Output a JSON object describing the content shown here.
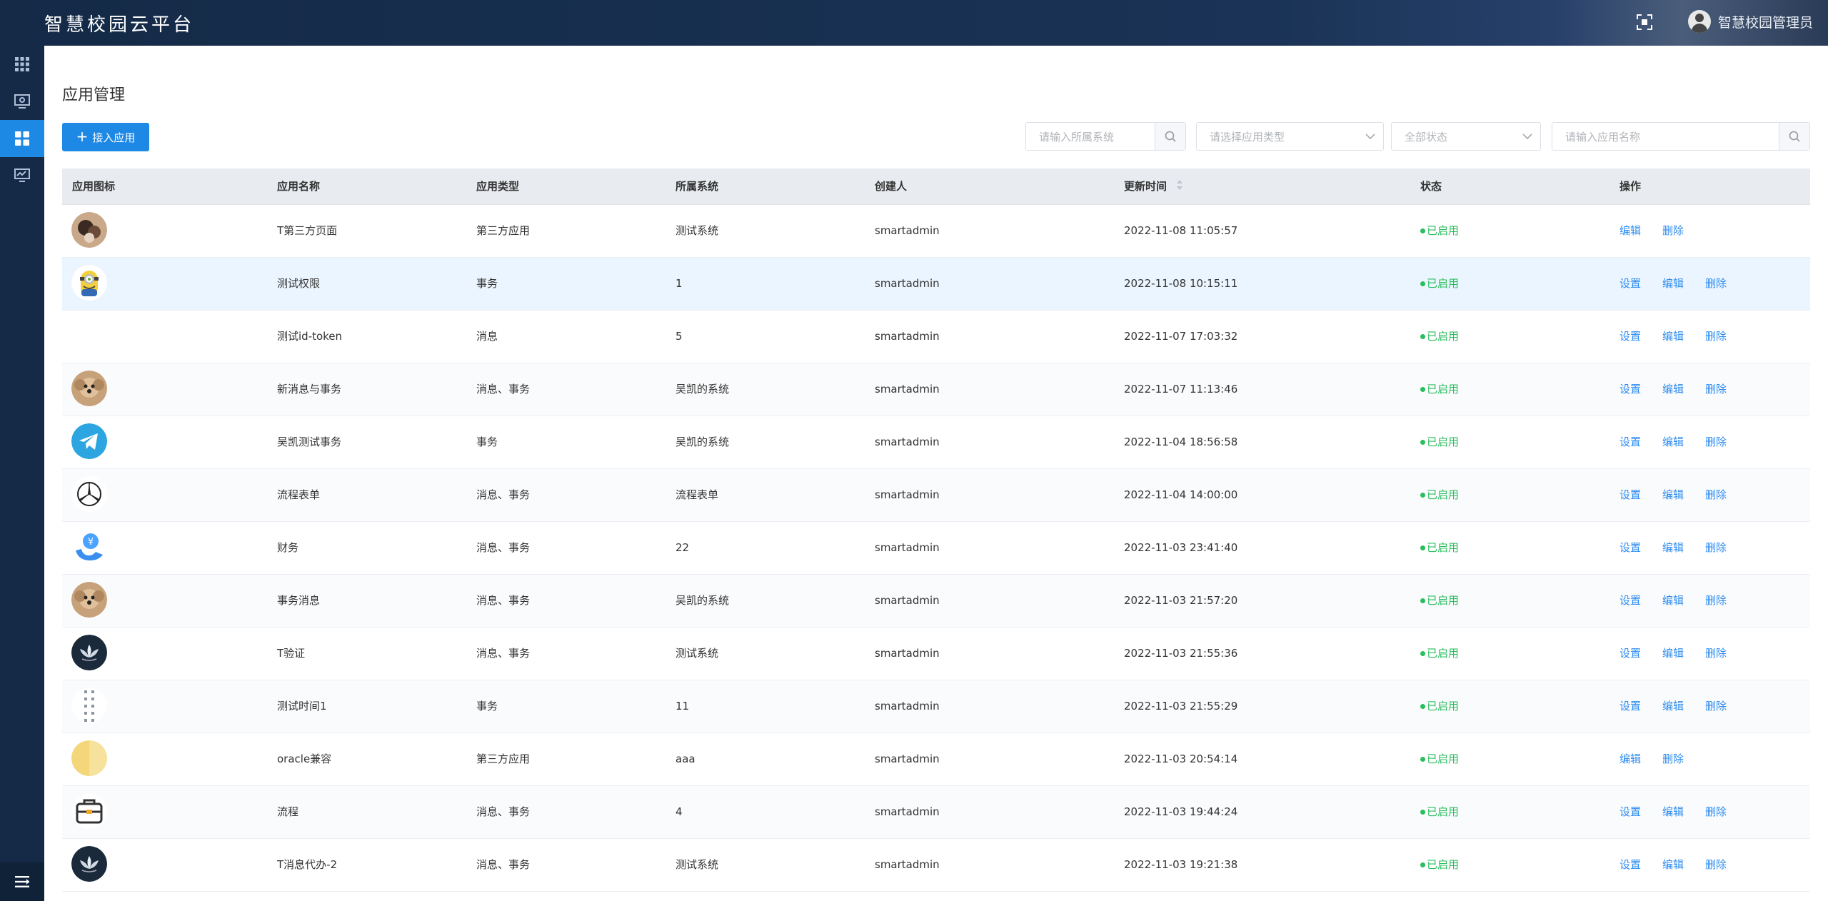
{
  "header": {
    "brand": "智慧校园云平台",
    "user_name": "智慧校园管理员"
  },
  "sidebar": {
    "items": [
      {
        "icon": "grid-apps-icon",
        "active": false
      },
      {
        "icon": "monitor-screen-icon",
        "active": false
      },
      {
        "icon": "dashboard-tiles-icon",
        "active": true
      },
      {
        "icon": "monitor-chart-icon",
        "active": false
      }
    ],
    "collapse_icon": "menu-collapse-icon"
  },
  "page": {
    "title": "应用管理",
    "add_button": "接入应用"
  },
  "filters": {
    "system_placeholder": "请输入所属系统",
    "type_placeholder": "请选择应用类型",
    "status_placeholder": "全部状态",
    "name_placeholder": "请输入应用名称"
  },
  "table": {
    "columns": [
      "应用图标",
      "应用名称",
      "应用类型",
      "所属系统",
      "创建人",
      "更新时间",
      "状态",
      "操作"
    ],
    "actions": {
      "settings": "设置",
      "edit": "编辑",
      "delete": "删除"
    },
    "rows": [
      {
        "icon": "photo-portrait",
        "name": "T第三方页面",
        "type": "第三方应用",
        "system": "测试系统",
        "creator": "smartadmin",
        "updated": "2022-11-08 11:05:57",
        "status": "已启用",
        "has_settings": false
      },
      {
        "icon": "minion-cartoon",
        "name": "测试权限",
        "type": "事务",
        "system": "1",
        "creator": "smartadmin",
        "updated": "2022-11-08 10:15:11",
        "status": "已启用",
        "has_settings": true
      },
      {
        "icon": "none",
        "name": "测试id-token",
        "type": "消息",
        "system": "5",
        "creator": "smartadmin",
        "updated": "2022-11-07 17:03:32",
        "status": "已启用",
        "has_settings": true
      },
      {
        "icon": "puppy-photo",
        "name": "新消息与事务",
        "type": "消息、事务",
        "system": "吴凯的系统",
        "creator": "smartadmin",
        "updated": "2022-11-07 11:13:46",
        "status": "已启用",
        "has_settings": true
      },
      {
        "icon": "telegram-logo",
        "name": "吴凯测试事务",
        "type": "事务",
        "system": "吴凯的系统",
        "creator": "smartadmin",
        "updated": "2022-11-04 18:56:58",
        "status": "已启用",
        "has_settings": true
      },
      {
        "icon": "mercedes-star",
        "name": "流程表单",
        "type": "消息、事务",
        "system": "流程表单",
        "creator": "smartadmin",
        "updated": "2022-11-04 14:00:00",
        "status": "已启用",
        "has_settings": true
      },
      {
        "icon": "finance-yuan",
        "name": "财务",
        "type": "消息、事务",
        "system": "22",
        "creator": "smartadmin",
        "updated": "2022-11-03 23:41:40",
        "status": "已启用",
        "has_settings": true
      },
      {
        "icon": "puppy-photo",
        "name": "事务消息",
        "type": "消息、事务",
        "system": "吴凯的系统",
        "creator": "smartadmin",
        "updated": "2022-11-03 21:57:20",
        "status": "已启用",
        "has_settings": true
      },
      {
        "icon": "lotus-dark",
        "name": "T验证",
        "type": "消息、事务",
        "system": "测试系统",
        "creator": "smartadmin",
        "updated": "2022-11-03 21:55:36",
        "status": "已启用",
        "has_settings": true
      },
      {
        "icon": "drag-dots",
        "name": "测试时间1",
        "type": "事务",
        "system": "11",
        "creator": "smartadmin",
        "updated": "2022-11-03 21:55:29",
        "status": "已启用",
        "has_settings": true
      },
      {
        "icon": "yellow-circle",
        "name": "oracle兼容",
        "type": "第三方应用",
        "system": "aaa",
        "creator": "smartadmin",
        "updated": "2022-11-03 20:54:14",
        "status": "已启用",
        "has_settings": false
      },
      {
        "icon": "briefcase",
        "name": "流程",
        "type": "消息、事务",
        "system": "4",
        "creator": "smartadmin",
        "updated": "2022-11-03 19:44:24",
        "status": "已启用",
        "has_settings": true
      },
      {
        "icon": "lotus-dark",
        "name": "T消息代办-2",
        "type": "消息、事务",
        "system": "测试系统",
        "creator": "smartadmin",
        "updated": "2022-11-03 19:21:38",
        "status": "已启用",
        "has_settings": true
      }
    ]
  }
}
